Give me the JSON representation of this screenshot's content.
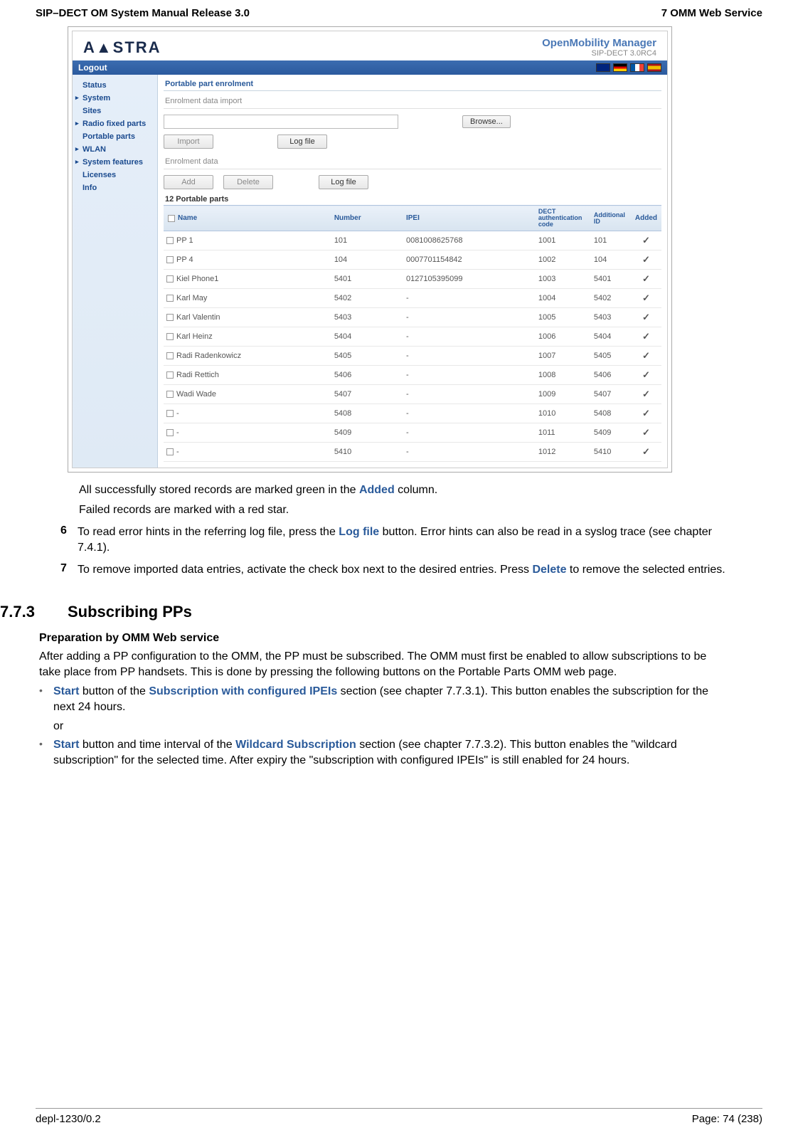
{
  "header": {
    "left": "SIP–DECT OM System Manual Release 3.0",
    "right": "7 OMM Web Service"
  },
  "screenshot": {
    "logo": "A▲STRA",
    "product_title": "OpenMobility Manager",
    "product_version": "SIP-DECT 3.0RC4",
    "logout": "Logout",
    "sidebar": {
      "items": [
        {
          "label": "Status",
          "exp": false
        },
        {
          "label": "System",
          "exp": true
        },
        {
          "label": "Sites",
          "exp": false
        },
        {
          "label": "Radio fixed parts",
          "exp": true
        },
        {
          "label": "Portable parts",
          "exp": false
        },
        {
          "label": "WLAN",
          "exp": true
        },
        {
          "label": "System features",
          "exp": true
        },
        {
          "label": "Licenses",
          "exp": false
        },
        {
          "label": "Info",
          "exp": false
        }
      ]
    },
    "main": {
      "title": "Portable part enrolment",
      "import_title": "Enrolment data import",
      "browse": "Browse...",
      "import_btn": "Import",
      "logfile_btn": "Log file",
      "data_title": "Enrolment data",
      "add_btn": "Add",
      "delete_btn": "Delete",
      "table_caption": "12 Portable parts",
      "columns": {
        "name": "Name",
        "number": "Number",
        "ipei": "IPEI",
        "dect": "DECT authentication code",
        "addid": "Additional ID",
        "added": "Added"
      },
      "rows": [
        {
          "name": "PP 1",
          "number": "101",
          "ipei": "0081008625768",
          "dect": "1001",
          "addid": "101",
          "added": "✓"
        },
        {
          "name": "PP 4",
          "number": "104",
          "ipei": "0007701154842",
          "dect": "1002",
          "addid": "104",
          "added": "✓"
        },
        {
          "name": "Kiel Phone1",
          "number": "5401",
          "ipei": "0127105395099",
          "dect": "1003",
          "addid": "5401",
          "added": "✓"
        },
        {
          "name": "Karl May",
          "number": "5402",
          "ipei": "-",
          "dect": "1004",
          "addid": "5402",
          "added": "✓"
        },
        {
          "name": "Karl Valentin",
          "number": "5403",
          "ipei": "-",
          "dect": "1005",
          "addid": "5403",
          "added": "✓"
        },
        {
          "name": "Karl Heinz",
          "number": "5404",
          "ipei": "-",
          "dect": "1006",
          "addid": "5404",
          "added": "✓"
        },
        {
          "name": "Radi Radenkowicz",
          "number": "5405",
          "ipei": "-",
          "dect": "1007",
          "addid": "5405",
          "added": "✓"
        },
        {
          "name": "Radi Rettich",
          "number": "5406",
          "ipei": "-",
          "dect": "1008",
          "addid": "5406",
          "added": "✓"
        },
        {
          "name": "Wadi Wade",
          "number": "5407",
          "ipei": "-",
          "dect": "1009",
          "addid": "5407",
          "added": "✓"
        },
        {
          "name": "-",
          "number": "5408",
          "ipei": "-",
          "dect": "1010",
          "addid": "5408",
          "added": "✓"
        },
        {
          "name": "-",
          "number": "5409",
          "ipei": "-",
          "dect": "1011",
          "addid": "5409",
          "added": "✓"
        },
        {
          "name": "-",
          "number": "5410",
          "ipei": "-",
          "dect": "1012",
          "addid": "5410",
          "added": "✓"
        }
      ]
    }
  },
  "text": {
    "p1a": "All successfully stored records are marked green in the ",
    "p1term": "Added",
    "p1b": " column.",
    "p2": "Failed records are marked with a red star.",
    "step6num": "6",
    "step6a": "To read error hints in the referring log file, press the ",
    "step6term": "Log file",
    "step6b": " button. Error hints can also be read in a syslog trace (see chapter 7.4.1).",
    "step7num": "7",
    "step7a": "To remove imported data entries, activate the check box next to the desired entries. Press ",
    "step7term": "Delete",
    "step7b": " to remove the selected entries.",
    "sec_num": "7.7.3",
    "sec_title": "Subscribing PPs",
    "sub_heading": "Preparation by OMM Web service",
    "para3": "After adding a PP configuration to the OMM, the PP must be subscribed. The OMM must first be enabled to allow subscriptions to be take place from PP handsets. This is done by pressing the following buttons on the Portable Parts OMM web page.",
    "b1term1": "Start",
    "b1a": " button of the ",
    "b1term2": "Subscription with configured IPEIs",
    "b1b": " section (see chapter 7.7.3.1). This button enables the subscription for the next 24 hours.",
    "or": "or",
    "b2term1": "Start",
    "b2a": " button and time interval of the ",
    "b2term2": "Wildcard Subscription",
    "b2b": " section (see chapter 7.7.3.2). This button enables the \"wildcard subscription\" for the selected time. After expiry the \"subscription with configured IPEIs\" is still enabled for 24 hours."
  },
  "footer": {
    "left": "depl-1230/0.2",
    "right": "Page: 74 (238)"
  }
}
